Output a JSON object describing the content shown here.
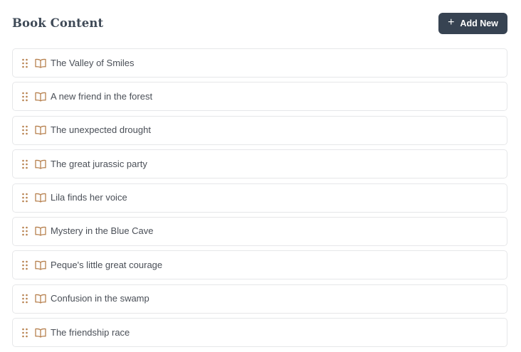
{
  "header": {
    "title": "Book Content",
    "add_button_label": "Add New",
    "add_button_icon": "plus-icon"
  },
  "colors": {
    "title": "#3f4a57",
    "button_bg": "#374352",
    "icon_accent": "#b7814f",
    "border": "#e6e7e9",
    "text": "#4a4f57"
  },
  "items": [
    {
      "label": "The Valley of Smiles"
    },
    {
      "label": "A new friend in the forest"
    },
    {
      "label": "The unexpected drought"
    },
    {
      "label": "The great jurassic party"
    },
    {
      "label": "Lila finds her voice"
    },
    {
      "label": "Mystery in the Blue Cave"
    },
    {
      "label": "Peque's little great courage"
    },
    {
      "label": "Confusion in the swamp"
    },
    {
      "label": "The friendship race"
    }
  ]
}
